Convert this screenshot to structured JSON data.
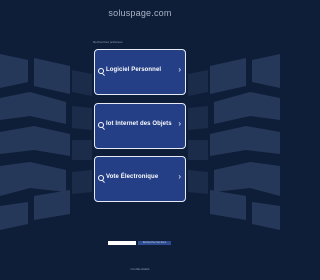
{
  "header": {
    "domain": "soluspage.com",
    "related_label": "Recherches préférées"
  },
  "links": [
    {
      "label": "Logiciel Personnel",
      "icon": "search-icon",
      "chevron": "›"
    },
    {
      "label": "Iot Internet des Objets",
      "icon": "search-icon",
      "chevron": "›"
    },
    {
      "label": "Vote Électronique",
      "icon": "search-icon",
      "chevron": "›"
    }
  ],
  "search": {
    "placeholder": "",
    "button_label": "Rechercher des liens"
  },
  "footer": {
    "privacy_label": "Confidentialité"
  },
  "colors": {
    "background": "#0f1e38",
    "card_fill": "#243f86",
    "card_border": "#e6ebf5",
    "band": "#2a3d60"
  }
}
